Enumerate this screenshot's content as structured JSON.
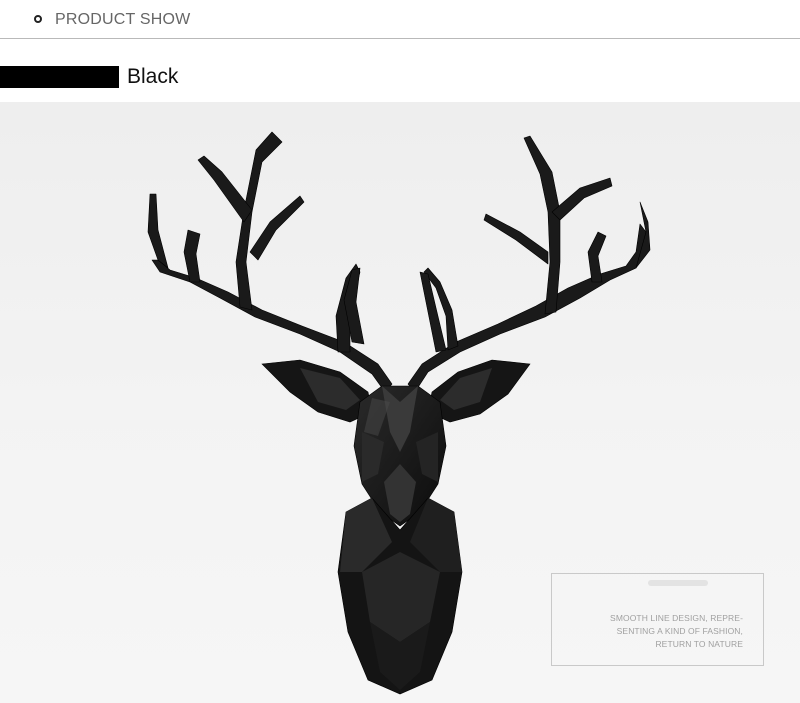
{
  "header": {
    "title": "PRODUCT SHOW"
  },
  "variant": {
    "label": "Black",
    "swatch_color": "#000000"
  },
  "caption": {
    "lines": [
      "SMOOTH LINE DESIGN, REPRE-",
      "SENTING A KIND OF FASHION,",
      "RETURN TO NATURE"
    ]
  },
  "product": {
    "image_icon": "deer-head-sculpture-icon"
  }
}
